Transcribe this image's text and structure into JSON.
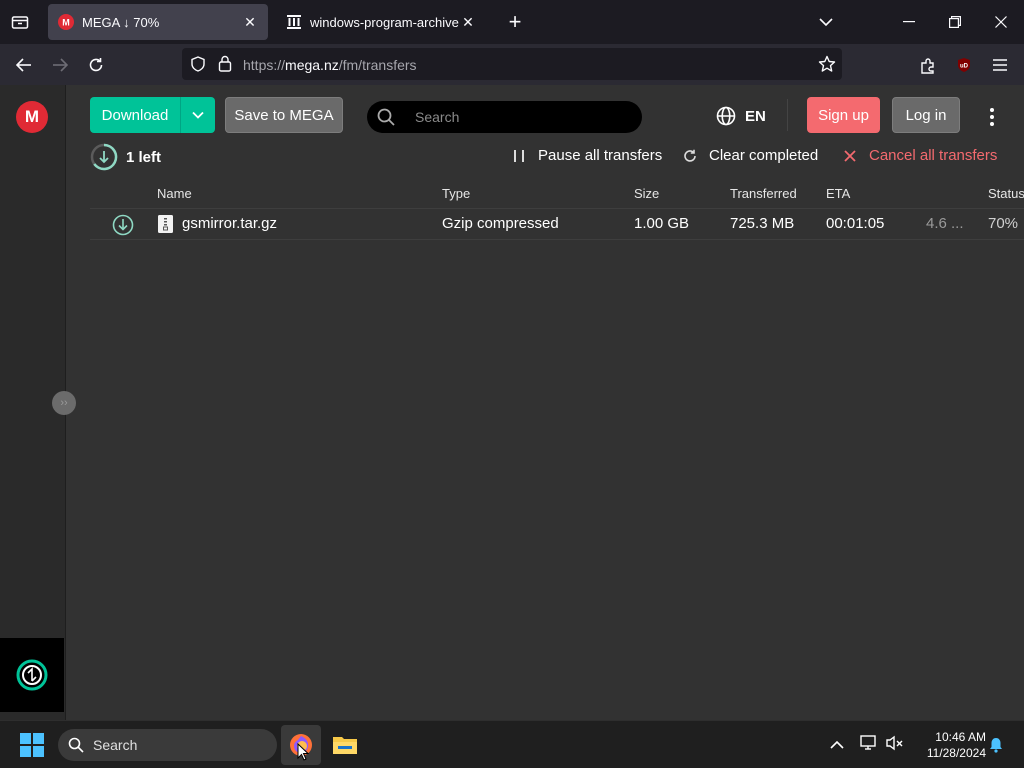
{
  "browser": {
    "tabs": [
      {
        "title": "MEGA ↓ 70%",
        "active": true,
        "favicon": "mega-icon"
      },
      {
        "title": "windows-program-archive dire",
        "active": false,
        "favicon": "archive-icon"
      }
    ],
    "url_prefix": "https://",
    "url_host": "mega.nz",
    "url_path": "/fm/transfers"
  },
  "toolbar": {
    "download_label": "Download",
    "save_label": "Save to MEGA",
    "search_placeholder": "Search",
    "language": "EN",
    "signup_label": "Sign up",
    "login_label": "Log in"
  },
  "transfers": {
    "remaining": "1 left",
    "pause_all": "Pause all transfers",
    "clear_completed": "Clear completed",
    "cancel_all": "Cancel all transfers",
    "columns": [
      "Name",
      "Type",
      "Size",
      "Transferred",
      "ETA",
      "Status"
    ],
    "rows": [
      {
        "name": "gsmirror.tar.gz",
        "type": "Gzip compressed",
        "size": "1.00 GB",
        "transferred": "725.3 MB",
        "eta": "00:01:05",
        "speed": "4.6 ...",
        "status": "70%"
      }
    ]
  },
  "taskbar": {
    "search_placeholder": "Search",
    "time": "10:46 AM",
    "date": "11/28/2024"
  },
  "colors": {
    "accent_green": "#00c398",
    "signup_red": "#f46a6f",
    "mega_red": "#e02a35",
    "cancel_red": "#f46a6f"
  }
}
